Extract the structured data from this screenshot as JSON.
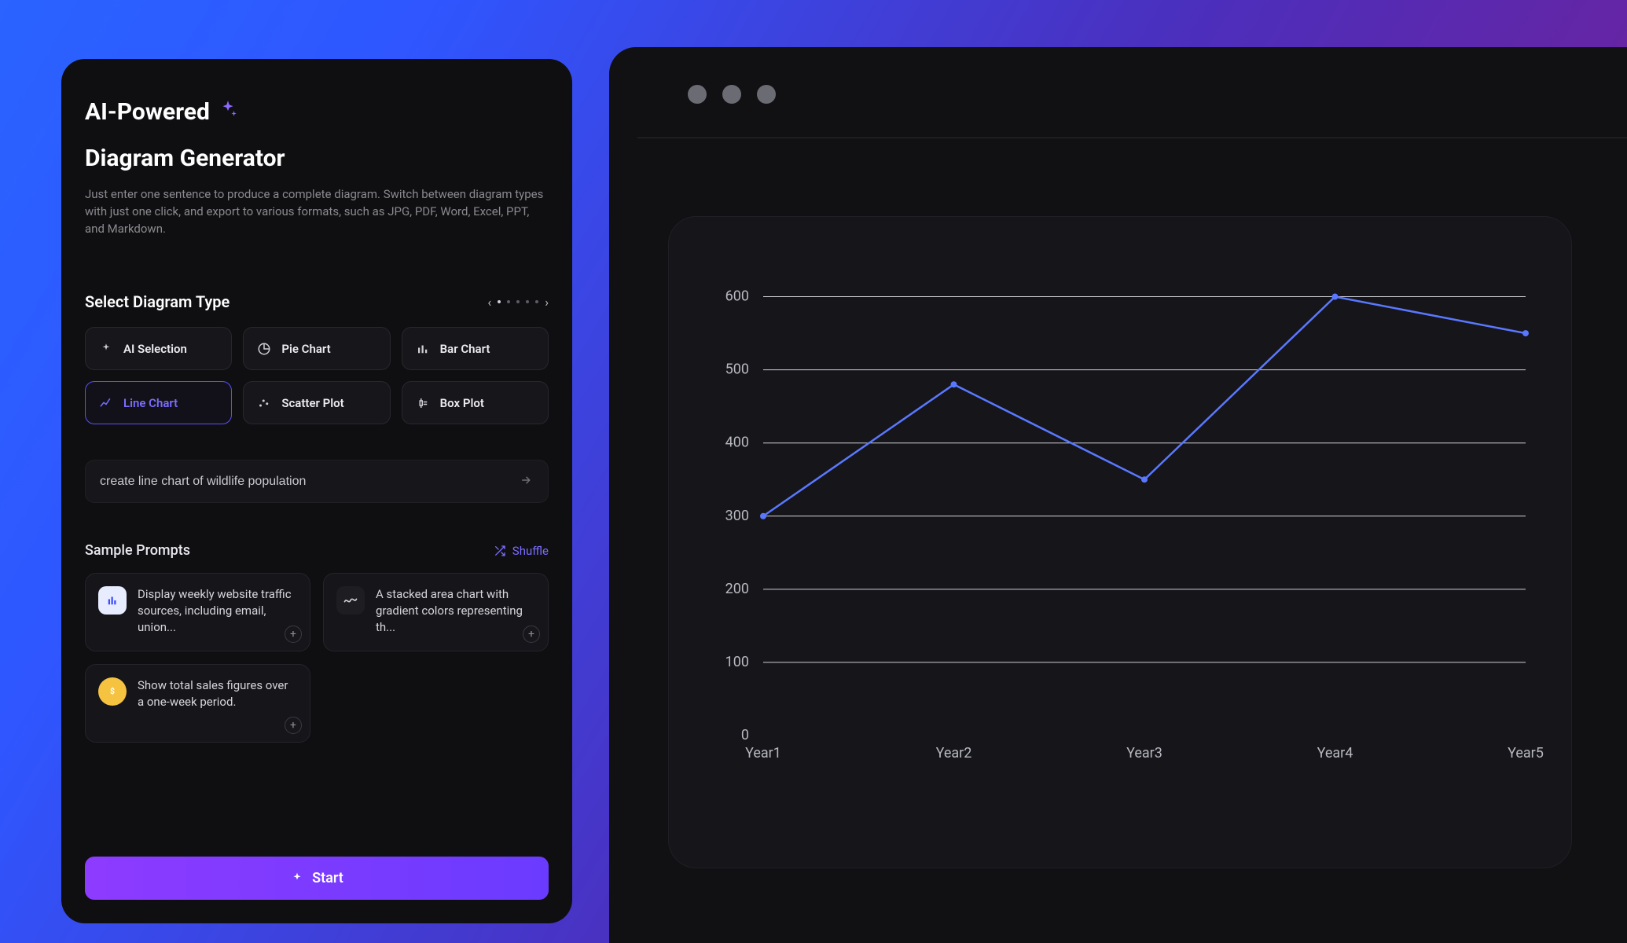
{
  "header": {
    "ai_label": "AI-Powered",
    "title": "Diagram Generator",
    "description": "Just enter one sentence to produce a complete diagram. Switch between diagram types with just one click, and export to various formats, such as JPG, PDF, Word, Excel, PPT, and Markdown."
  },
  "diagram_types": {
    "section_title": "Select Diagram Type",
    "items": [
      {
        "label": "AI Selection",
        "icon": "sparkle-icon",
        "active": false
      },
      {
        "label": "Pie Chart",
        "icon": "pie-icon",
        "active": false
      },
      {
        "label": "Bar Chart",
        "icon": "bar-icon",
        "active": false
      },
      {
        "label": "Line Chart",
        "icon": "line-icon",
        "active": true
      },
      {
        "label": "Scatter Plot",
        "icon": "scatter-icon",
        "active": false
      },
      {
        "label": "Box Plot",
        "icon": "box-icon",
        "active": false
      }
    ]
  },
  "prompt_input": {
    "value": "create line chart of wildlife population"
  },
  "samples": {
    "title": "Sample Prompts",
    "shuffle_label": "Shuffle",
    "cards": [
      {
        "text": "Display weekly website traffic sources, including email, union...",
        "icon": "bar-blue"
      },
      {
        "text": "A stacked area chart with gradient colors representing th...",
        "icon": "wave-dark"
      },
      {
        "text": "Show total sales figures over a one-week period.",
        "icon": "coin-gold"
      }
    ]
  },
  "start_label": "Start",
  "chart_data": {
    "type": "line",
    "categories": [
      "Year1",
      "Year2",
      "Year3",
      "Year4",
      "Year5"
    ],
    "values": [
      300,
      480,
      350,
      600,
      550
    ],
    "xlabel": "",
    "ylabel": "",
    "ylim": [
      0,
      650
    ],
    "yticks": [
      100,
      200,
      300,
      400,
      500,
      600
    ],
    "line_color": "#5a78ff"
  }
}
